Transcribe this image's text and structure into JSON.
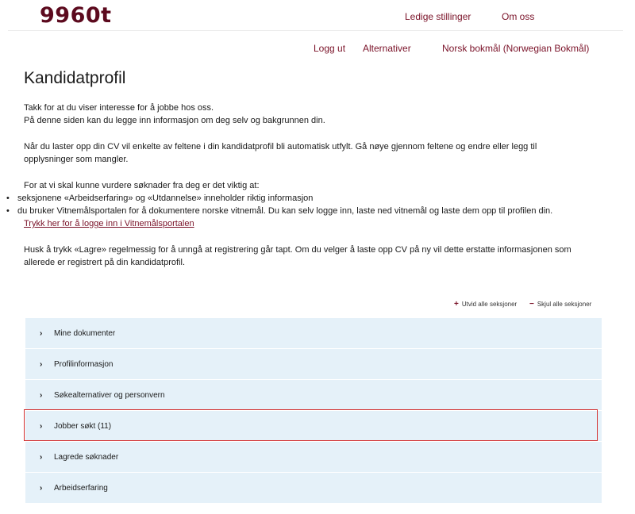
{
  "header": {
    "logo": "9960t",
    "nav": [
      "Ledige stillinger",
      "Om oss"
    ]
  },
  "usernav": {
    "logout": "Logg ut",
    "options": "Alternativer",
    "language": "Norsk bokmål (Norwegian Bokmål)"
  },
  "page": {
    "title": "Kandidatprofil",
    "intro_line1": "Takk for at du viser interesse for å jobbe hos oss.",
    "intro_line2": "På denne siden kan du legge inn informasjon om deg selv og bakgrunnen din.",
    "cv_line1": "Når du laster opp din CV vil enkelte av feltene i din kandidatprofil bli automatisk utfylt. Gå nøye gjennom feltene og endre eller legg til",
    "cv_line2": "opplysninger som mangler.",
    "evaluate_intro": "For at vi skal kunne vurdere søknader fra deg er det viktig at:",
    "bullets": [
      "seksjonene «Arbeidserfaring» og «Utdannelse» inneholder riktig informasjon",
      "du bruker Vitnemålsportalen for å dokumentere norske vitnemål. Du kan selv logge inn, laste ned vitnemål og laste dem opp til profilen din."
    ],
    "vitnemal_link": "Trykk her for å logge inn i Vitnemålsportalen",
    "save_line1": "Husk å trykk «Lagre» regelmessig for å unngå at registrering går tapt. Om du velger å laste opp CV på ny vil dette erstatte informasjonen som",
    "save_line2": "allerede er registrert på din kandidatprofil."
  },
  "controls": {
    "expand_all": "Utvid alle seksjoner",
    "collapse_all": "Skjul alle seksjoner"
  },
  "sections": [
    "Mine dokumenter",
    "Profilinformasjon",
    "Søkealternativer og personvern",
    "Jobber søkt (11)",
    "Lagrede søknader",
    "Arbeidserfaring"
  ],
  "colors": {
    "brand": "#5c0a1e",
    "link": "#7a1228",
    "section_bg": "#e5f1f9",
    "highlight": "#d32f2f"
  }
}
